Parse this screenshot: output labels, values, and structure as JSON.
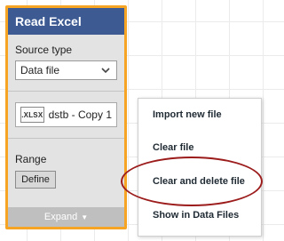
{
  "node": {
    "title": "Read Excel",
    "source_type_label": "Source type",
    "source_type_value": "Data file",
    "file_badge": ".XLSX",
    "file_name": "dstb - Copy 1",
    "range_label": "Range",
    "define_label": "Define",
    "expand_label": "Expand"
  },
  "menu": {
    "items": [
      {
        "label": "Import new file"
      },
      {
        "label": "Clear file"
      },
      {
        "label": "Clear and delete file"
      },
      {
        "label": "Show in Data Files"
      }
    ]
  },
  "annotation": {
    "highlighted_item": "Clear and delete file"
  },
  "colors": {
    "header": "#3d5a93",
    "node_border": "#f5a523",
    "highlight": "#9c1c1c"
  },
  "icons": {
    "dropdown": "chevron-down-icon",
    "file": "xlsx-file-icon",
    "expand": "caret-down-icon"
  }
}
